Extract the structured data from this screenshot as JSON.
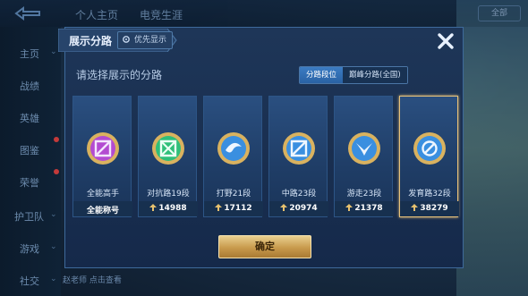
{
  "background": {
    "tabs": [
      "个人主页",
      "电竞生涯"
    ],
    "sidebar": [
      "主页",
      "战绩",
      "英雄",
      "图鉴",
      "荣誉",
      "护卫队",
      "游戏",
      "社交"
    ],
    "select_label": "全部",
    "bottom_text": "赵老师 点击查看"
  },
  "dialog": {
    "title": "展示分路",
    "priority_label": "优先显示",
    "prompt": "请选择展示的分路",
    "segments": [
      {
        "label": "分路段位",
        "active": true
      },
      {
        "label": "巅峰分路(全国)",
        "active": false
      }
    ],
    "cards": [
      {
        "label": "全能高手",
        "score": "全能称号",
        "emblem": "all-round",
        "color": "#b34bd1",
        "selected": false,
        "show_arrow": false
      },
      {
        "label": "对抗路19段",
        "score": "14988",
        "emblem": "clash-lane",
        "color": "#2fbf7a",
        "selected": false,
        "show_arrow": true
      },
      {
        "label": "打野21段",
        "score": "17112",
        "emblem": "jungle",
        "color": "#3a8fe0",
        "selected": false,
        "show_arrow": true
      },
      {
        "label": "中路23段",
        "score": "20974",
        "emblem": "mid-lane",
        "color": "#3a8fe0",
        "selected": false,
        "show_arrow": true
      },
      {
        "label": "游走23段",
        "score": "21378",
        "emblem": "roam",
        "color": "#3a8fe0",
        "selected": false,
        "show_arrow": true
      },
      {
        "label": "发育路32段",
        "score": "38279",
        "emblem": "farm-lane",
        "color": "#3a8fe0",
        "selected": true,
        "show_arrow": true
      }
    ],
    "confirm_label": "确定"
  }
}
